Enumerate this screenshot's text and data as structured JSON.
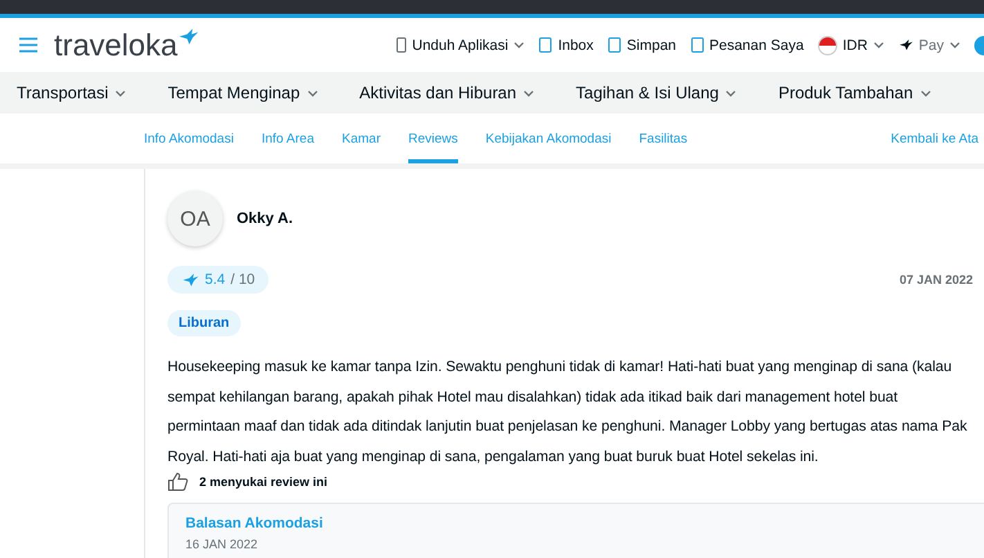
{
  "header": {
    "logo": "traveloka",
    "links": [
      {
        "label": "Unduh Aplikasi",
        "kind": "dropdown"
      },
      {
        "label": "Inbox",
        "kind": "link"
      },
      {
        "label": "Simpan",
        "kind": "link"
      },
      {
        "label": "Pesanan Saya",
        "kind": "link"
      },
      {
        "label": "IDR",
        "kind": "currency"
      },
      {
        "label": "Pay",
        "kind": "pay"
      }
    ]
  },
  "categories": [
    "Transportasi",
    "Tempat Menginap",
    "Aktivitas dan Hiburan",
    "Tagihan & Isi Ulang",
    "Produk Tambahan"
  ],
  "subnav": {
    "tabs": [
      {
        "label": "Info Akomodasi",
        "selected": false
      },
      {
        "label": "Info Area",
        "selected": false
      },
      {
        "label": "Kamar",
        "selected": false
      },
      {
        "label": "Reviews",
        "selected": true
      },
      {
        "label": "Kebijakan Akomodasi",
        "selected": false
      },
      {
        "label": "Fasilitas",
        "selected": false
      }
    ],
    "back_to_top": "Kembali ke Ata"
  },
  "review": {
    "initials": "OA",
    "name": "Okky A.",
    "score": "5.4",
    "scale": "/ 10",
    "date": "07 JAN 2022",
    "tag": "Liburan",
    "text_lines": [
      "Housekeeping masuk ke kamar tanpa Izin. Sewaktu penghuni tidak di kamar! Hati-hati buat yang menginap di sana (kalau",
      "sempat kehilangan barang, apakah pihak Hotel mau disalahkan) tidak ada itikad baik dari management hotel buat",
      "permintaan maaf dan tidak ada ditindak lanjutin buat penjelasan ke penghuni. Manager Lobby yang bertugas atas nama Pak",
      "Royal. Hati-hati aja buat yang menginap di sana, pengalaman yang buat buruk buat Hotel sekelas ini."
    ],
    "likes": "2 menyukai review ini",
    "reply": {
      "title": "Balasan Akomodasi",
      "date": "16 JAN 2022"
    }
  }
}
